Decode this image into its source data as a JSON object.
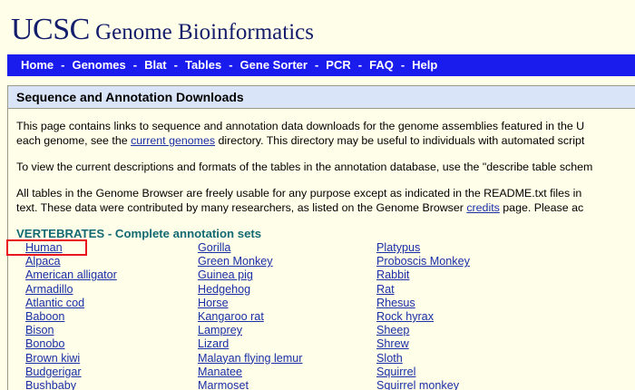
{
  "header": {
    "logo_ucsc": "UCSC",
    "logo_rest": "Genome Bioinformatics"
  },
  "nav": {
    "items": [
      "Home",
      "Genomes",
      "Blat",
      "Tables",
      "Gene Sorter",
      "PCR",
      "FAQ",
      "Help"
    ],
    "separator": "-"
  },
  "panel": {
    "title": "Sequence and Annotation Downloads",
    "para1": {
      "line1": "This page contains links to sequence and annotation data downloads for the genome assemblies featured in the U",
      "line2_before": "each genome, see the ",
      "line2_link": "current genomes",
      "line2_after": " directory. This directory may be useful to individuals with automated script"
    },
    "para2": "To view the current descriptions and formats of the tables in the annotation database, use the \"describe table schem",
    "para3": {
      "line1": "All tables in the Genome Browser are freely usable for any purpose except as indicated in the README.txt files in",
      "line2_before": "text. These data were contributed by many researchers, as listed on the Genome Browser ",
      "line2_link": "credits",
      "line2_after": " page. Please ac"
    },
    "section_heading": "VERTEBRATES - Complete annotation sets",
    "organisms": {
      "col1": [
        "Human",
        "Alpaca",
        "American alligator",
        "Armadillo",
        "Atlantic cod",
        "Baboon",
        "Bison",
        "Bonobo",
        "Brown kiwi",
        "Budgerigar",
        "Bushbaby"
      ],
      "col2": [
        "Gorilla",
        "Green Monkey",
        "Guinea pig",
        "Hedgehog",
        "Horse",
        "Kangaroo rat",
        "Lamprey",
        "Lizard",
        "Malayan flying lemur",
        "Manatee",
        "Marmoset"
      ],
      "col3": [
        "Platypus",
        "Proboscis Monkey",
        "Rabbit",
        "Rat",
        "Rhesus",
        "Rock hyrax",
        "Sheep",
        "Shrew",
        "Sloth",
        "Squirrel",
        "Squirrel monkey"
      ]
    }
  },
  "colors": {
    "page_bg": "#fffee8",
    "logo": "#131d6b",
    "nav_bg": "#1a1cee",
    "panel_title_bg": "#d9e4f8",
    "link": "#1a2fa6",
    "section_heading": "#136a73",
    "highlight": "#e8171d"
  }
}
